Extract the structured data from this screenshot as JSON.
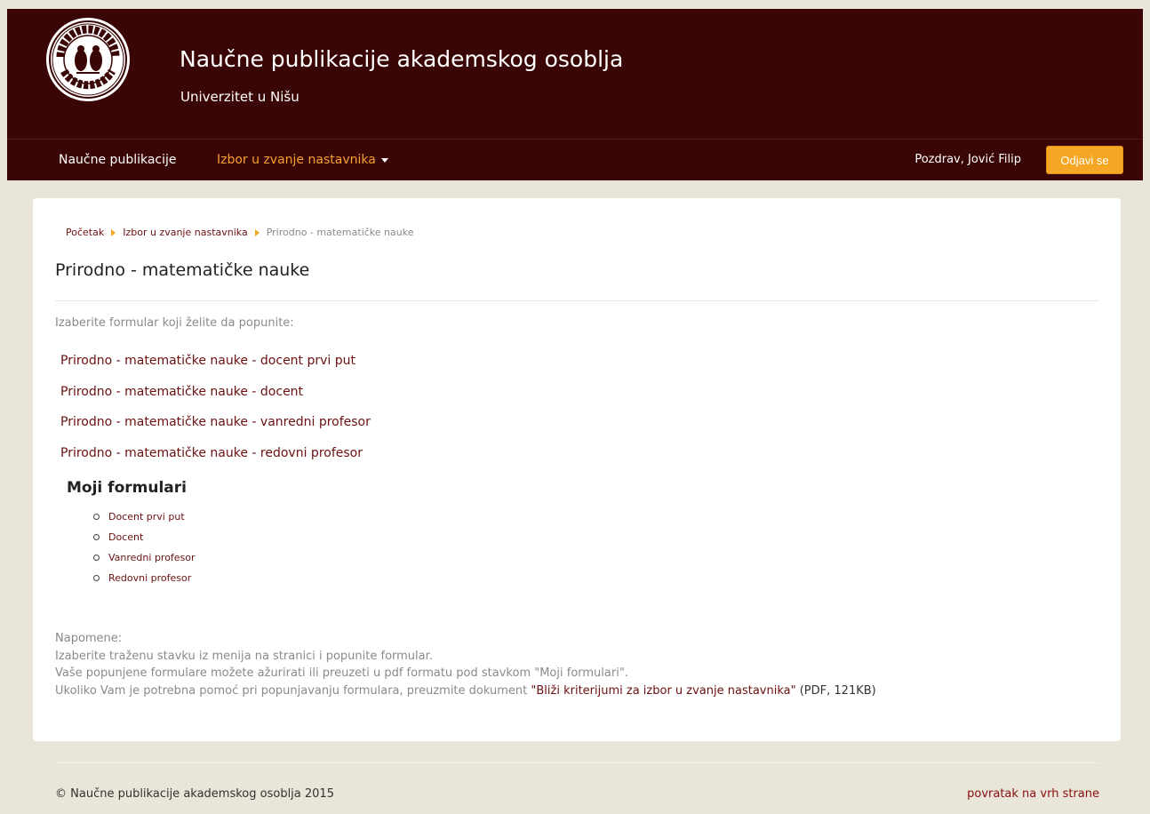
{
  "header": {
    "title": "Naučne publikacije akademskog osoblja",
    "subtitle": "Univerzitet u Nišu",
    "logo_icon": "university-seal-icon"
  },
  "nav": {
    "publications": "Naučne publikacije",
    "izbor": "Izbor u zvanje nastavnika",
    "greeting": "Pozdrav, Jović Filip",
    "logout": "Odjavi se"
  },
  "breadcrumb": {
    "home": "Početak",
    "section": "Izbor u zvanje nastavnika",
    "current": "Prirodno - matematičke nauke"
  },
  "page": {
    "title": "Prirodno - matematičke nauke",
    "intro": "Izaberite formular koji želite da popunite:",
    "forms": [
      "Prirodno - matematičke nauke - docent prvi put",
      "Prirodno - matematičke nauke - docent",
      "Prirodno - matematičke nauke - vanredni profesor",
      "Prirodno - matematičke nauke - redovni profesor"
    ],
    "my_forms_title": "Moji formulari",
    "my_forms": [
      "Docent prvi put",
      "Docent",
      "Vanredni profesor",
      "Redovni profesor"
    ]
  },
  "notes": {
    "heading": "Napomene:",
    "line1": "Izaberite traženu stavku iz menija na stranici i popunite formular.",
    "line2": "Vaše popunjene formulare možete ažurirati ili preuzeti u pdf formatu pod stavkom \"Moji formulari\".",
    "line3_prefix": "Ukoliko Vam je potrebna pomoć pri popunjavanju formulara, preuzmite dokument",
    "line3_link": "\"Bliži kriterijumi za izbor u zvanje nastavnika\"",
    "line3_suffix": "(PDF, 121KB)"
  },
  "footer": {
    "copyright": "© Naučne publikacije akademskog osoblja 2015",
    "back_to_top": "povratak na vrh strane"
  },
  "colors": {
    "header_bg": "#3a0505",
    "page_bg": "#e9e5d8",
    "accent_orange": "#f5a623",
    "link": "#6b1010"
  }
}
